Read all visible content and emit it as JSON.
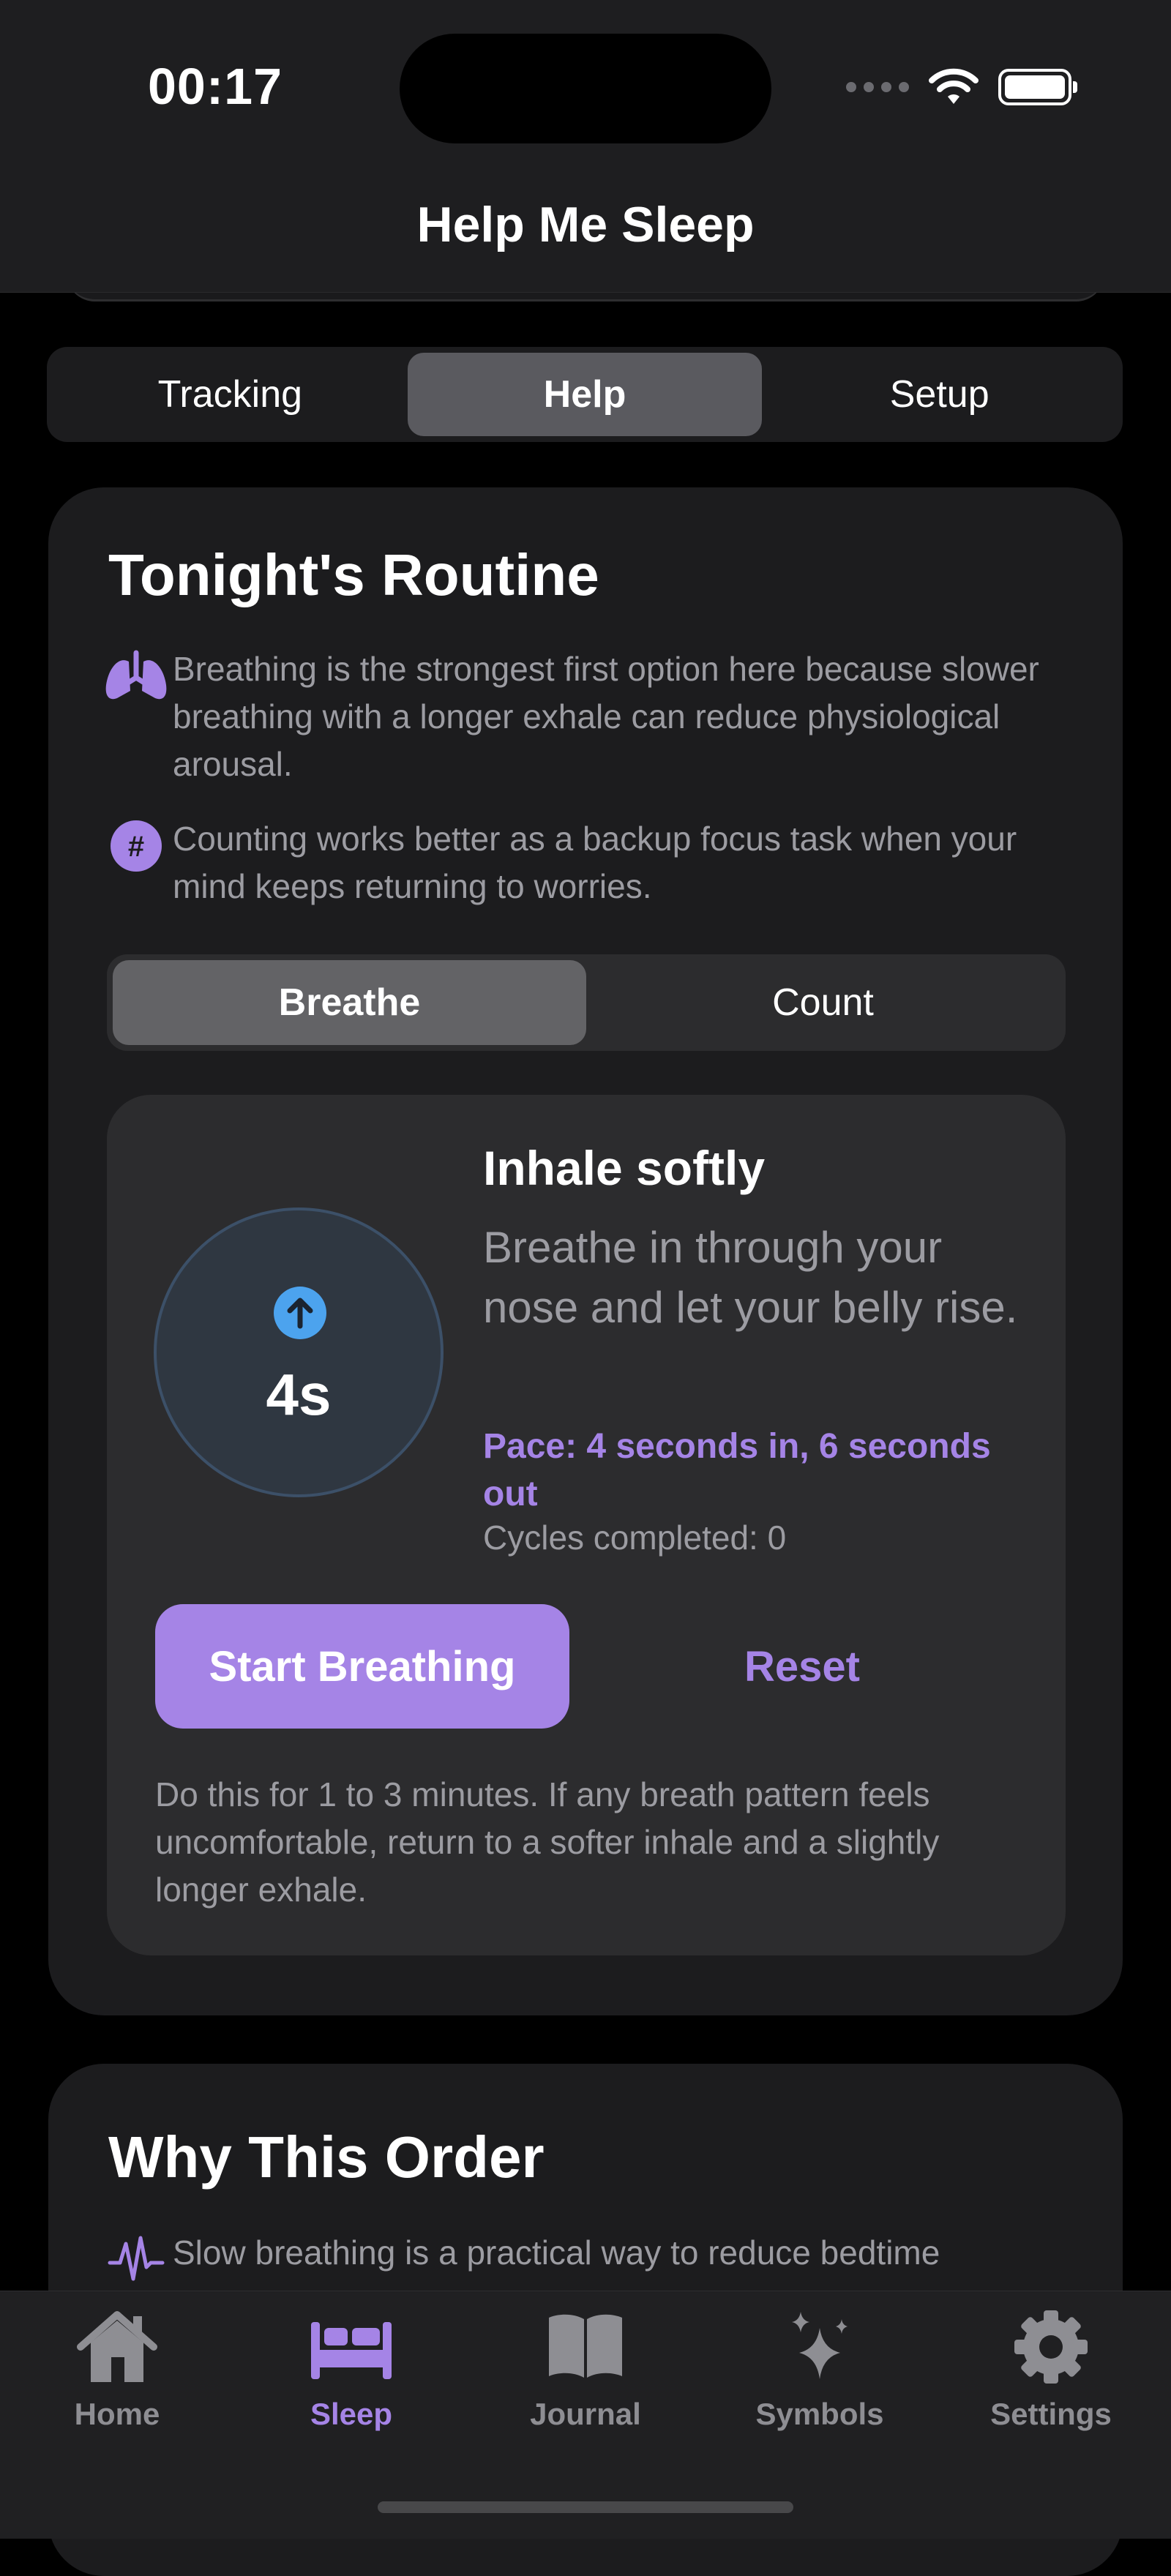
{
  "status_bar": {
    "time": "00:17"
  },
  "nav": {
    "title": "Help Me Sleep"
  },
  "main_tabs": [
    {
      "label": "Tracking",
      "selected": false
    },
    {
      "label": "Help",
      "selected": true
    },
    {
      "label": "Setup",
      "selected": false
    }
  ],
  "routine": {
    "title": "Tonight's Routine",
    "info": [
      {
        "icon": "lungs-icon",
        "text": "Breathing is the strongest first option here because slower breathing with a longer exhale can reduce physiological arousal."
      },
      {
        "icon": "number-icon",
        "text": "Counting works better as a backup focus task when your mind keeps returning to worries."
      }
    ],
    "mode_tabs": [
      {
        "label": "Breathe",
        "selected": true
      },
      {
        "label": "Count",
        "selected": false
      }
    ],
    "breathing": {
      "countdown": "4s",
      "phase_title": "Inhale softly",
      "phase_description": "Breathe in through your nose and let your belly rise.",
      "pace": "Pace: 4 seconds in, 6 seconds out",
      "cycles": "Cycles completed: 0",
      "start_label": "Start Breathing",
      "reset_label": "Reset",
      "note": "Do this for 1 to 3 minutes. If any breath pattern feels uncomfortable, return to a softer inhale and a slightly longer exhale."
    }
  },
  "why": {
    "title": "Why This Order",
    "first_item": "Slow breathing is a practical way to reduce bedtime"
  },
  "tab_bar": [
    {
      "label": "Home",
      "icon": "house-icon",
      "selected": false
    },
    {
      "label": "Sleep",
      "icon": "bed-icon",
      "selected": true
    },
    {
      "label": "Journal",
      "icon": "book-icon",
      "selected": false
    },
    {
      "label": "Symbols",
      "icon": "sparkles-icon",
      "selected": false
    },
    {
      "label": "Settings",
      "icon": "gear-icon",
      "selected": false
    }
  ],
  "colors": {
    "accent": "#a584e6",
    "background": "#000000",
    "card": "#1c1c1e",
    "inner_card": "#2c2c2e",
    "secondary_text": "#9c9ca2",
    "arrow_blue": "#4ca3ee"
  }
}
